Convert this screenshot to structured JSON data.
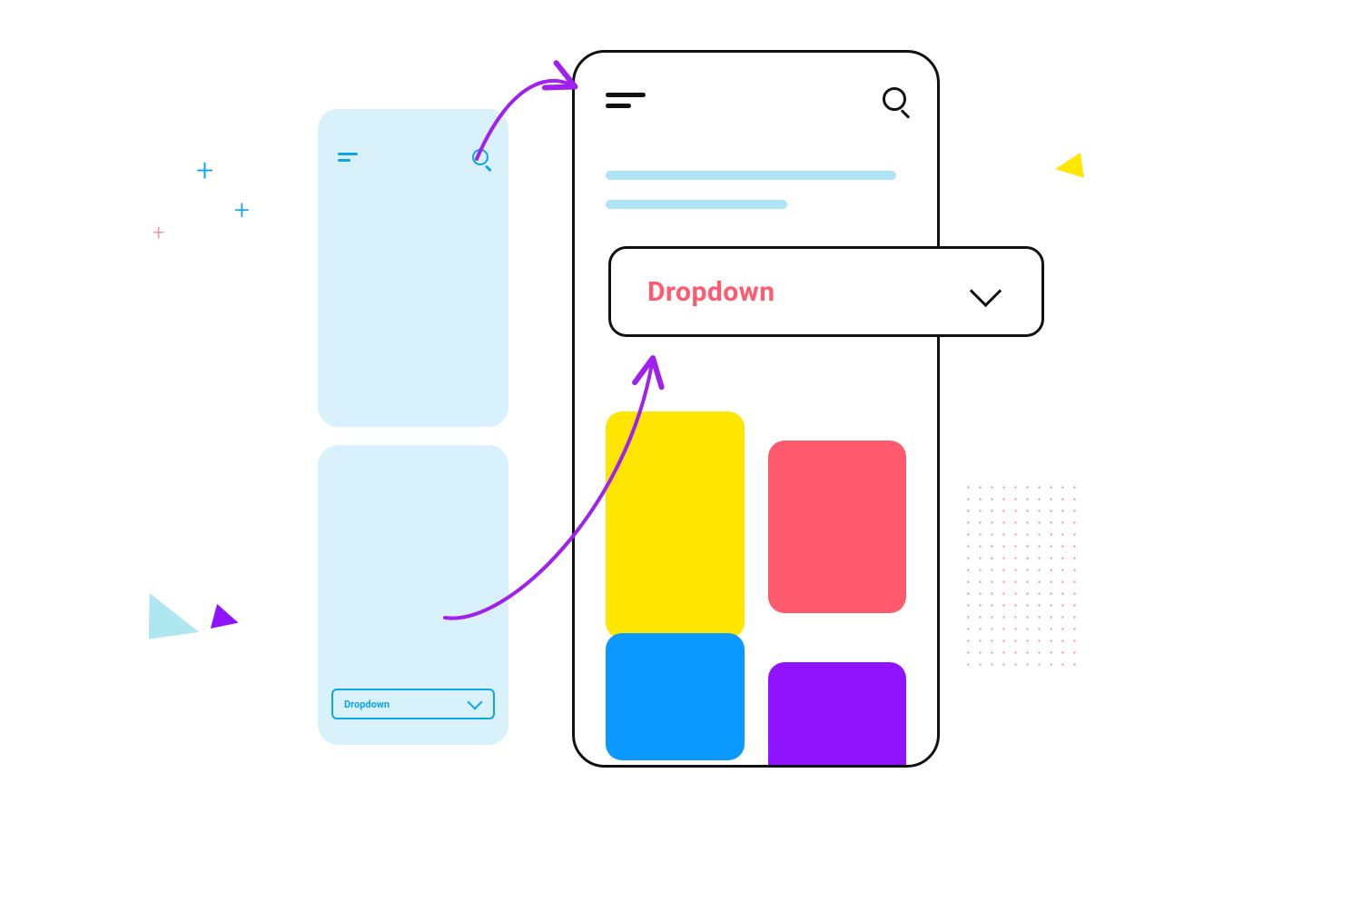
{
  "mini": {
    "dropdown_label": "Dropdown"
  },
  "phone": {
    "dropdown_label": "Dropdown"
  }
}
